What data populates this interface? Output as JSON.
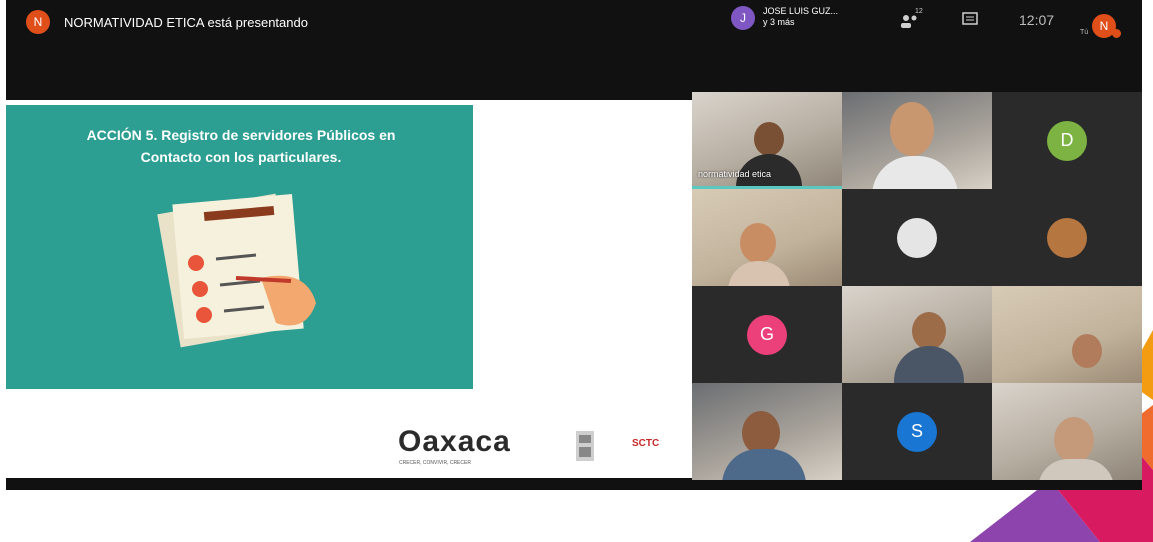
{
  "meeting": {
    "presenter": {
      "avatar_letter": "N",
      "text": "NORMATIVIDAD ETICA está presentando",
      "avatar_color": "#e04f1a"
    },
    "participants_summary": {
      "avatar_letter": "J",
      "name": "JOSE LUIS GUZ...",
      "more": "y 3 más",
      "avatar_color": "#7e57c2"
    },
    "people_count": "12",
    "time": "12:07",
    "self_label": "Tú",
    "self_avatar_letter": "N",
    "self_avatar_color": "#e04f1a"
  },
  "slide": {
    "title_line1": "ACCIÓN 5. Registro de servidores Públicos en",
    "title_line2": "Contacto con los particulares.",
    "logo_text": "Oaxaca",
    "logo_tagline": "CRECER, CONVIVIR, CRECER",
    "org_text": "SCTC",
    "panel_color": "#2c9e92"
  },
  "grid": {
    "tiles": [
      {
        "label": "normatividad etica",
        "speaking": true
      },
      {
        "label": ""
      },
      {
        "letter": "D",
        "color": "#7cb342"
      },
      {
        "label": ""
      },
      {
        "label": ""
      },
      {
        "label": ""
      },
      {
        "letter": "G",
        "color": "#ec407a"
      },
      {
        "label": ""
      },
      {
        "label": ""
      },
      {
        "label": ""
      },
      {
        "letter": "S",
        "color": "#1976d2"
      },
      {
        "label": ""
      }
    ]
  }
}
